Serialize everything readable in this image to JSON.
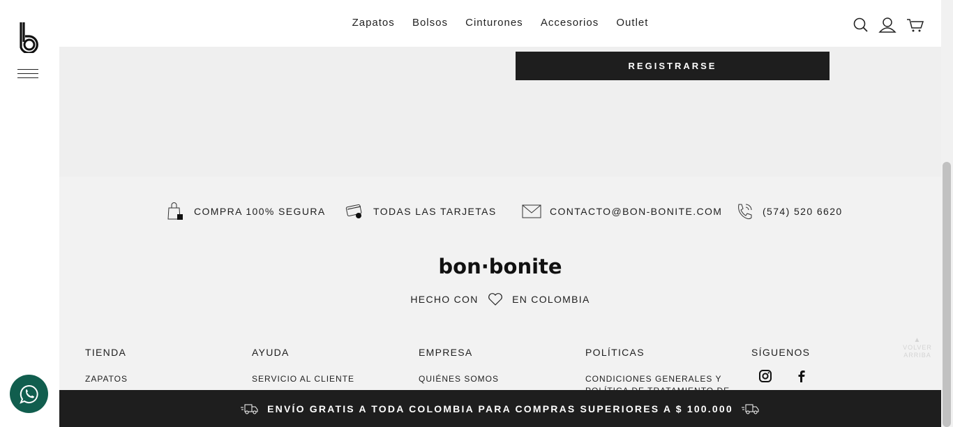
{
  "header": {
    "nav": [
      "Zapatos",
      "Bolsos",
      "Cinturones",
      "Accesorios",
      "Outlet"
    ],
    "icons": [
      "search-icon",
      "user-icon",
      "cart-icon"
    ]
  },
  "register": {
    "button_label": "REGISTRARSE"
  },
  "features": [
    {
      "icon": "secure-bag-icon",
      "label": "COMPRA 100% SEGURA"
    },
    {
      "icon": "credit-card-icon",
      "label": "TODAS LAS TARJETAS"
    },
    {
      "icon": "mail-icon",
      "label": "CONTACTO@BON-BONITE.COM"
    },
    {
      "icon": "phone-icon",
      "label": "(574) 520 6620"
    }
  ],
  "brand": {
    "wordmark": "bon·bonite",
    "hecho_left": "HECHO CON",
    "hecho_right": "EN COLOMBIA"
  },
  "columns": [
    {
      "title": "TIENDA",
      "links": [
        "ZAPATOS"
      ]
    },
    {
      "title": "AYUDA",
      "links": [
        "SERVICIO AL CLIENTE"
      ]
    },
    {
      "title": "EMPRESA",
      "links": [
        "QUIÉNES SOMOS"
      ]
    },
    {
      "title": "POLÍTICAS",
      "links": [
        "CONDICIONES GENERALES Y",
        "POLÍTICA DE TRATAMIENTO DE"
      ]
    },
    {
      "title": "SÍGUENOS",
      "links": []
    }
  ],
  "social": [
    "instagram-icon",
    "facebook-icon"
  ],
  "back_to_top": {
    "line1": "VOLVER",
    "line2": "ARRIBA"
  },
  "shipping_bar": {
    "text": "ENVÍO GRATIS A TODA COLOMBIA PARA COMPRAS SUPERIORES A $ 100.000"
  },
  "colors": {
    "dark": "#1e1e1e",
    "whatsapp": "#115e4e",
    "panel": "#efefef"
  }
}
